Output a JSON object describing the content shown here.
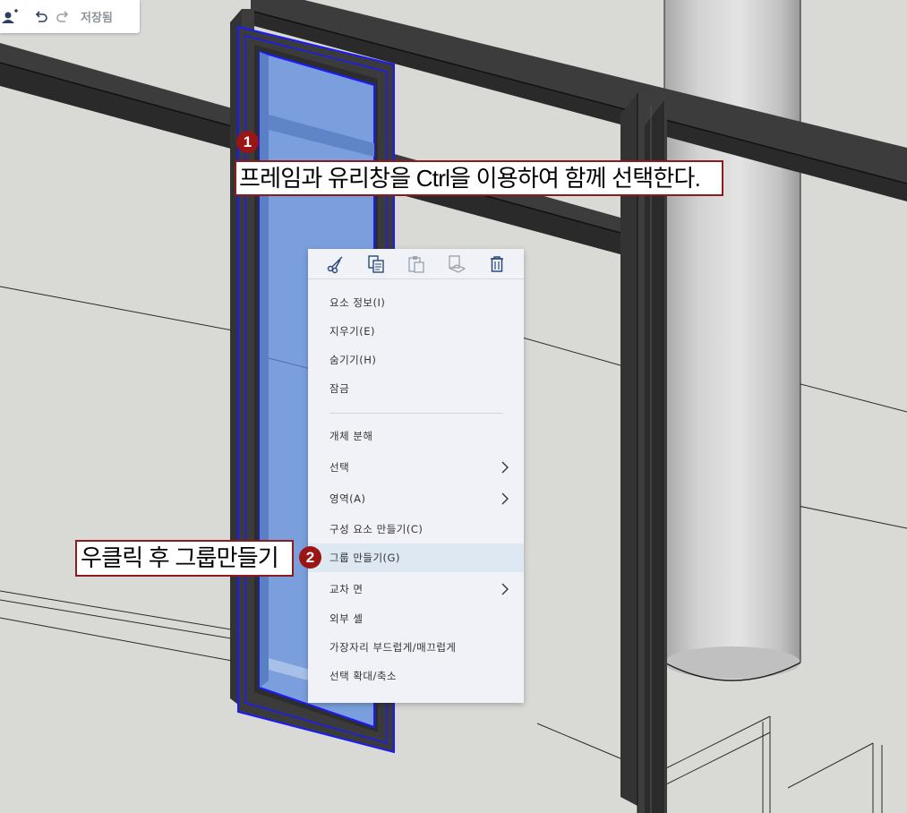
{
  "toolbar": {
    "add_user_icon": "person-add-icon",
    "undo_icon": "undo-icon",
    "redo_icon": "redo-icon",
    "saved_label": "저장됨"
  },
  "context_menu": {
    "icons": [
      "scissors-icon",
      "copy-icon",
      "paste-icon",
      "paste-in-place-icon",
      "trash-icon"
    ],
    "items": [
      {
        "label": "요소 정보(I)"
      },
      {
        "label": "지우기(E)"
      },
      {
        "label": "숨기기(H)"
      },
      {
        "label": "잠금"
      },
      {
        "label": "개체 분해"
      },
      {
        "label": "선택",
        "submenu": true
      },
      {
        "label": "영역(A)",
        "submenu": true
      },
      {
        "label": "구성 요소 만들기(C)"
      },
      {
        "label": "그룹 만들기(G)",
        "highlighted": true
      },
      {
        "label": "교차 면",
        "submenu": true
      },
      {
        "label": "외부 셸"
      },
      {
        "label": "가장자리 부드럽게/매끄럽게"
      },
      {
        "label": "선택 확대/축소"
      }
    ]
  },
  "annotations": {
    "step1": {
      "number": "1",
      "text": "프레임과 유리창을 Ctrl을 이용하여 함께 선택한다."
    },
    "step2": {
      "number": "2",
      "text": "우클릭 후 그룹만들기"
    }
  },
  "colors": {
    "selection": "#1a1aff",
    "glass": "#7b9fdc",
    "frame": "#3a3a3a",
    "callout_border": "#8b1c1c",
    "badge": "#9b1515",
    "menu_highlight": "#dde8f3"
  }
}
